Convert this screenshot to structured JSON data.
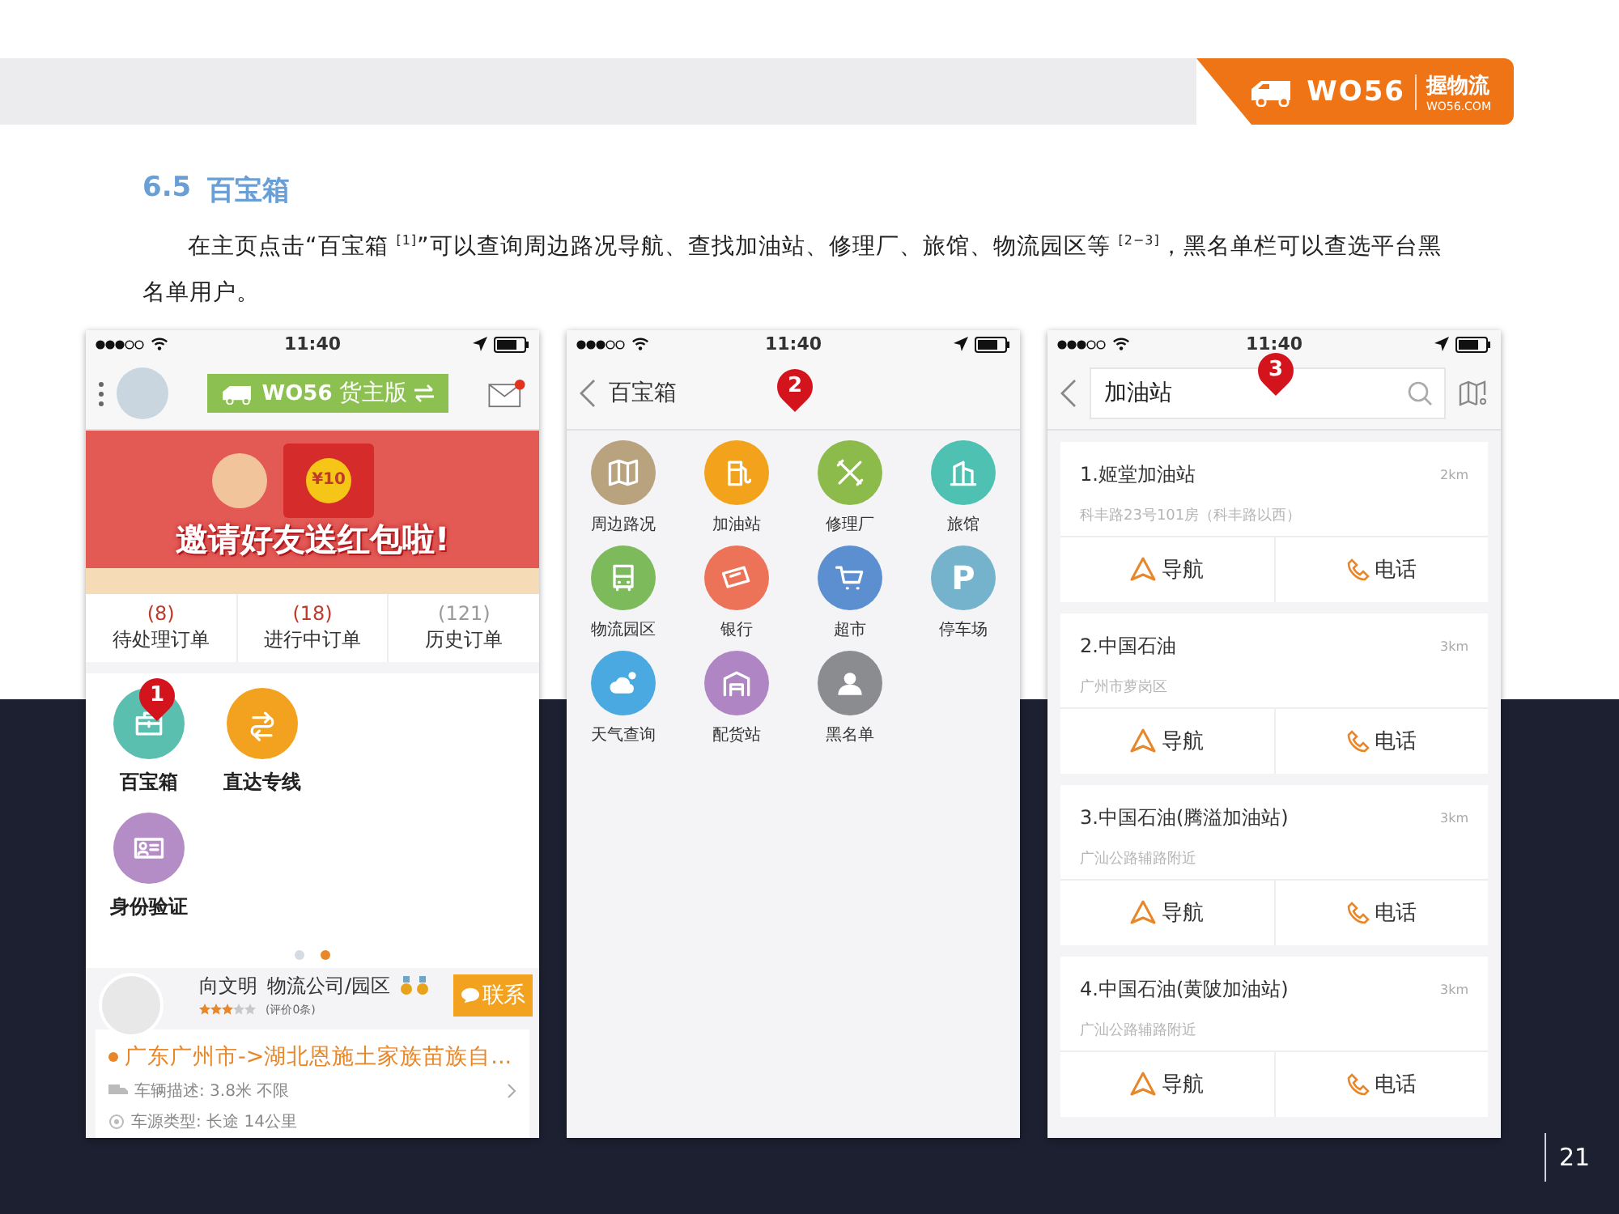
{
  "header": {
    "logo_mark": "WO56",
    "brand_name": "握物流",
    "brand_url": "WO56.COM"
  },
  "section": {
    "number": "6.5",
    "title": "百宝箱"
  },
  "paragraph": "在主页点击“百宝箱 $^{[1]}$”可以查询周边路况导航、查找加油站、修理厂、旅馆、物流园区等 $^{[2−3]}$，黑名单栏可以查选平台黑名单用户。",
  "phones": [
    {
      "kind": "home",
      "time": "11:40",
      "marker": "1",
      "app_button": {
        "logo": "WO56",
        "label": "货主版"
      },
      "banner": {
        "amount": "¥10",
        "headline": "邀请好友送红包啦!"
      },
      "order_stats": [
        {
          "count": "(8)",
          "label": "待处理订单",
          "color": "#c0392b"
        },
        {
          "count": "(18)",
          "label": "进行中订单",
          "color": "#c0392b"
        },
        {
          "count": "(121)",
          "label": "历史订单",
          "color": "#9a9a9a"
        }
      ],
      "shortcuts": [
        {
          "label": "百宝箱",
          "color": "#5bbfb0"
        },
        {
          "label": "直达专线",
          "color": "#f2a21e"
        },
        {
          "label": "身份验证",
          "color": "#b48cc6"
        }
      ],
      "pages": [
        {
          "selected": false
        },
        {
          "selected": true
        }
      ],
      "listing": {
        "name": "向文明",
        "company": "物流公司/园区",
        "stars": 3,
        "reviews": "(评价0条)",
        "contact": "联系",
        "route": "广东广州市->湖北恩施土家族苗族自...",
        "vehicle": "车辆描述: 3.8米 不限",
        "source": "车源类型: 长途 14公里"
      }
    },
    {
      "kind": "toolbox",
      "time": "11:40",
      "marker": "2",
      "title": "百宝箱",
      "items": [
        {
          "label": "周边路况",
          "color": "#b9a27e"
        },
        {
          "label": "加油站",
          "color": "#f3a21c"
        },
        {
          "label": "修理厂",
          "color": "#8cbb4c"
        },
        {
          "label": "旅馆",
          "color": "#4ec1b3"
        },
        {
          "label": "物流园区",
          "color": "#7cba5c"
        },
        {
          "label": "银行",
          "color": "#ec7258"
        },
        {
          "label": "超市",
          "color": "#5b8fd0"
        },
        {
          "label": "停车场",
          "color": "#75b3cc",
          "glyph": "P"
        },
        {
          "label": "天气查询",
          "color": "#4aa9e0"
        },
        {
          "label": "配货站",
          "color": "#b085c4"
        },
        {
          "label": "黑名单",
          "color": "#8a8c90"
        }
      ]
    },
    {
      "kind": "search",
      "time": "11:40",
      "marker": "3",
      "query": "加油站",
      "results": [
        {
          "name": "1.姬堂加油站",
          "distance": "2km",
          "address": "科丰路23号101房（科丰路以西）",
          "navigate": "导航",
          "call": "电话"
        },
        {
          "name": "2.中国石油",
          "distance": "3km",
          "address": "广州市萝岗区",
          "navigate": "导航",
          "call": "电话"
        },
        {
          "name": "3.中国石油(腾溢加油站)",
          "distance": "3km",
          "address": "广汕公路辅路附近",
          "navigate": "导航",
          "call": "电话"
        },
        {
          "name": "4.中国石油(黄陂加油站)",
          "distance": "3km",
          "address": "广汕公路辅路附近",
          "navigate": "导航",
          "call": "电话"
        }
      ]
    }
  ],
  "page_number": "21"
}
